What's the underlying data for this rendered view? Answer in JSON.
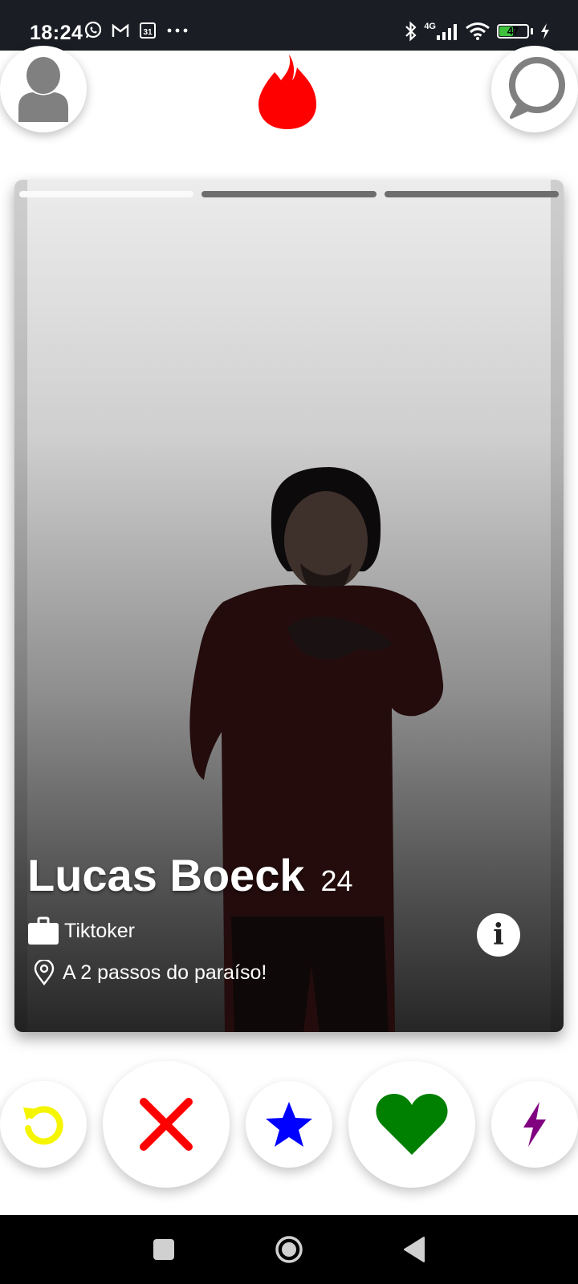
{
  "status_bar": {
    "time": "18:24",
    "network": "4G",
    "battery_percent": "47"
  },
  "header": {
    "profile_icon": "person-icon",
    "logo_icon": "flame-icon",
    "chat_icon": "chat-bubble-icon"
  },
  "card": {
    "photo_count": 3,
    "active_photo_index": 0,
    "name": "Lucas Boeck",
    "age": "24",
    "job": "Tiktoker",
    "location": "A 2 passos do paraíso!",
    "info_label": "i"
  },
  "actions": [
    {
      "name": "rewind",
      "icon": "rewind-icon",
      "color": "#f5f500"
    },
    {
      "name": "nope",
      "icon": "x-icon",
      "color": "#ff0000"
    },
    {
      "name": "super-like",
      "icon": "star-icon",
      "color": "#0000ff"
    },
    {
      "name": "like",
      "icon": "heart-icon",
      "color": "#008000"
    },
    {
      "name": "boost",
      "icon": "lightning-icon",
      "color": "#800080"
    }
  ],
  "colors": {
    "brand": "#ff0000",
    "status_bar_bg": "#1a1d23",
    "battery_fill": "#3ec23e"
  }
}
